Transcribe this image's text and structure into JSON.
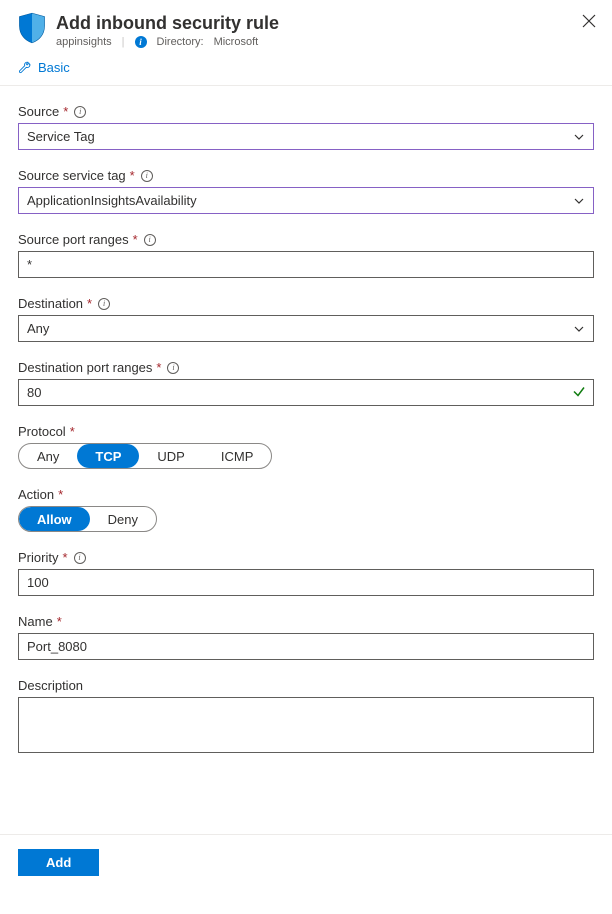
{
  "header": {
    "title": "Add inbound security rule",
    "resource": "appinsights",
    "directory_label": "Directory:",
    "directory_value": "Microsoft"
  },
  "toolbar": {
    "basic_label": "Basic"
  },
  "fields": {
    "source": {
      "label": "Source",
      "value": "Service Tag",
      "required": true,
      "info": true
    },
    "source_tag": {
      "label": "Source service tag",
      "value": "ApplicationInsightsAvailability",
      "required": true,
      "info": true
    },
    "source_ports": {
      "label": "Source port ranges",
      "value": "*",
      "required": true,
      "info": true
    },
    "destination": {
      "label": "Destination",
      "value": "Any",
      "required": true,
      "info": true
    },
    "dest_ports": {
      "label": "Destination port ranges",
      "value": "80",
      "required": true,
      "info": true,
      "valid": true
    },
    "protocol": {
      "label": "Protocol",
      "required": true,
      "options": [
        "Any",
        "TCP",
        "UDP",
        "ICMP"
      ],
      "selected": "TCP"
    },
    "action": {
      "label": "Action",
      "required": true,
      "options": [
        "Allow",
        "Deny"
      ],
      "selected": "Allow"
    },
    "priority": {
      "label": "Priority",
      "value": "100",
      "required": true,
      "info": true
    },
    "name": {
      "label": "Name",
      "value": "Port_8080",
      "required": true
    },
    "description": {
      "label": "Description",
      "value": ""
    }
  },
  "footer": {
    "add_label": "Add"
  }
}
